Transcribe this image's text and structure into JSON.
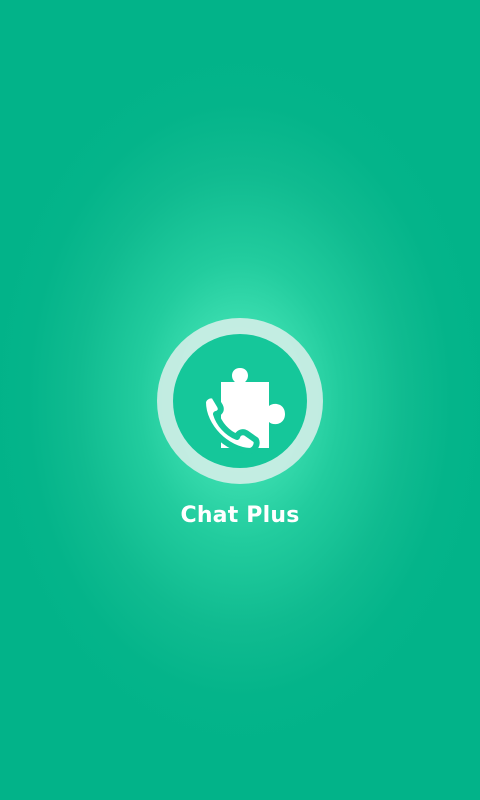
{
  "app": {
    "name": "Chat Plus"
  },
  "logo": {
    "icon": "puzzle-phone-icon"
  },
  "colors": {
    "background_edge": "#02b389",
    "background_center": "#5ef0c0",
    "logo_core": "#15c79a",
    "logo_ring": "#dcf0eb",
    "text": "#ffffff"
  }
}
